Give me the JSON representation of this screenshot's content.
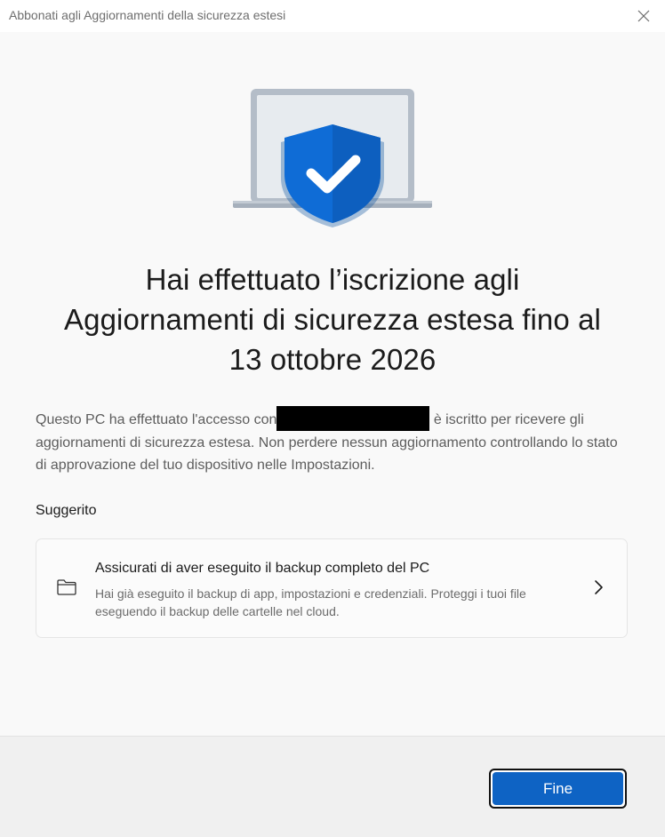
{
  "window": {
    "title": "Abbonati agli Aggiornamenti della sicurezza estesi",
    "close_icon": "close-icon"
  },
  "illustration": {
    "icon": "laptop-shield-check-icon",
    "shield_color": "#0f6cd6",
    "laptop_color": "#b8c1cc"
  },
  "headline": {
    "line1": "Hai effettuato l’iscrizione agli",
    "line2": "Aggiornamenti di sicurezza estesa fino al",
    "line3": "13 ottobre 2026"
  },
  "body": {
    "part1": "Questo PC ha effettuato l'accesso con",
    "part2": "è iscritto per ricevere gli aggiornamenti di sicurezza estesa. Non perdere nessun aggiornamento controllando lo stato di approvazione del tuo dispositivo nelle Impostazioni."
  },
  "suggested": {
    "label": "Suggerito",
    "card": {
      "icon": "folder-icon",
      "title": "Assicurati di aver eseguito il backup completo del PC",
      "description": "Hai già eseguito il backup di app, impostazioni e credenziali. Proteggi i tuoi file eseguendo il backup delle cartelle nel cloud.",
      "chevron": "chevron-right-icon"
    }
  },
  "footer": {
    "done_label": "Fine",
    "accent": "#0e63c4"
  }
}
